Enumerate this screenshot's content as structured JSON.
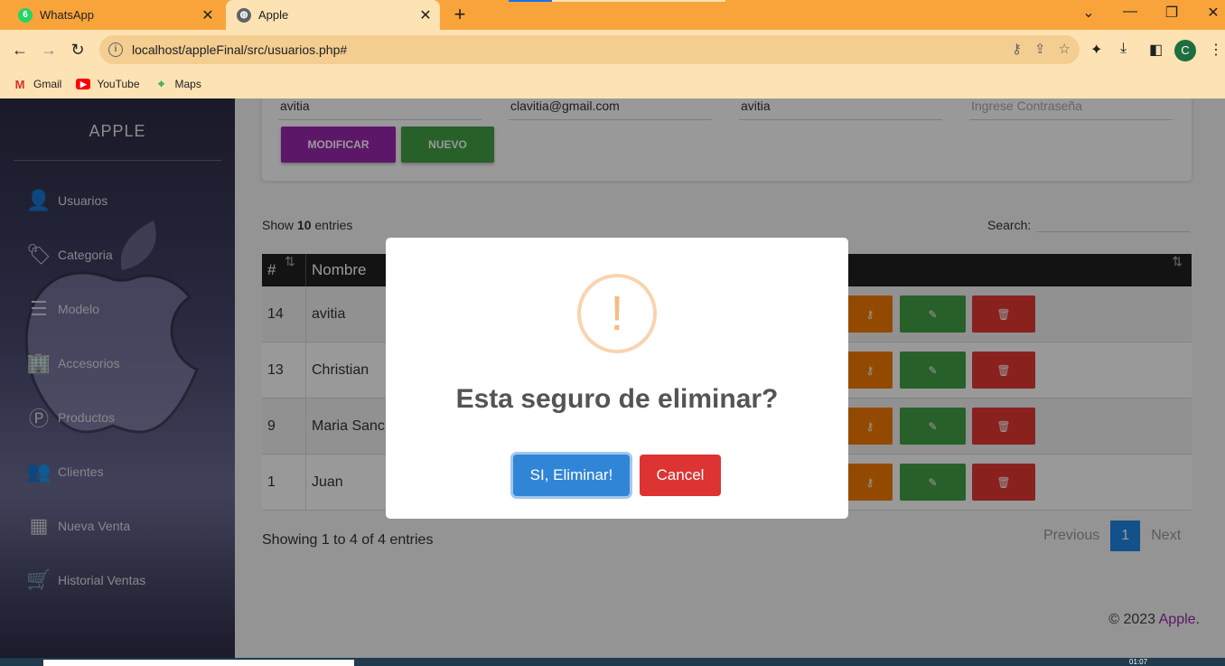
{
  "browser": {
    "tabs": [
      {
        "title": "WhatsApp",
        "close": "✕"
      },
      {
        "title": "Apple",
        "close": "✕"
      }
    ],
    "new_tab": "+",
    "url": "localhost/appleFinal/src/usuarios.php#",
    "profile_initial": "C",
    "bookmarks": [
      "Gmail",
      "YouTube",
      "Maps"
    ]
  },
  "sidebar": {
    "brand": "APPLE",
    "items": [
      {
        "label": "Usuarios",
        "icon": "👤"
      },
      {
        "label": "Categoria",
        "icon": "🏷"
      },
      {
        "label": "Modelo",
        "icon": "☰"
      },
      {
        "label": "Accesorios",
        "icon": "🏢"
      },
      {
        "label": "Productos",
        "icon": "Ⓟ"
      },
      {
        "label": "Clientes",
        "icon": "👥"
      },
      {
        "label": "Nueva Venta",
        "icon": "▦"
      },
      {
        "label": "Historial Ventas",
        "icon": "🛒"
      }
    ]
  },
  "form": {
    "fields": [
      "avitia",
      "clavitia@gmail.com",
      "avitia",
      "Ingrese Contraseña"
    ],
    "modify_label": "MODIFICAR",
    "new_label": "NUEVO"
  },
  "datatable": {
    "show_prefix": "Show",
    "show_value": "10",
    "show_suffix": "entries",
    "search_label": "Search:",
    "headers": [
      "#",
      "Nombre"
    ],
    "rows": [
      {
        "id": "14",
        "name": "avitia"
      },
      {
        "id": "13",
        "name": "Christian"
      },
      {
        "id": "9",
        "name": "Maria Sanc"
      },
      {
        "id": "1",
        "name": "Juan"
      }
    ],
    "info": "Showing 1 to 4 of 4 entries",
    "previous": "Previous",
    "current_page": "1",
    "next": "Next"
  },
  "modal": {
    "icon": "!",
    "title": "Esta seguro de eliminar?",
    "confirm": "SI, Eliminar!",
    "cancel": "Cancel"
  },
  "footer": {
    "copy": "© 2023",
    "brand": "Apple",
    "dot": "."
  },
  "taskbar": {
    "time": "01:07"
  },
  "colors": {
    "tabbar": "#f9a43b",
    "purple": "#9c27b0",
    "green": "#43a047",
    "orange": "#f57c00",
    "red": "#e53935",
    "confirm_blue": "#3085d6",
    "cancel_red": "#dd3333"
  }
}
